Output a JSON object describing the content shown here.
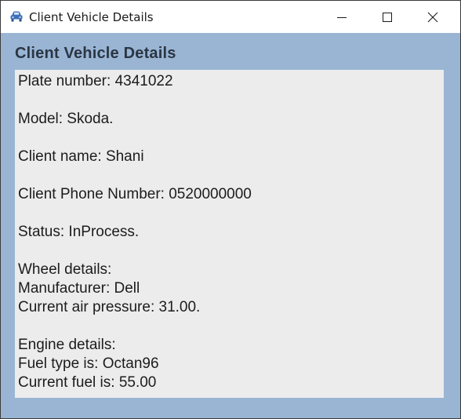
{
  "window": {
    "title": "Client Vehicle Details",
    "icon": "car-icon"
  },
  "controls": {
    "minimize": "minimize-icon",
    "maximize": "maximize-icon",
    "close": "close-icon"
  },
  "form": {
    "heading": "Client Vehicle Details"
  },
  "details": {
    "plate": "Plate number: 4341022",
    "model": "Model: Skoda.",
    "client_name": "Client name: Shani",
    "client_phone": "Client Phone Number: 0520000000",
    "status": "Status: InProcess.",
    "wheel_header": "Wheel details:",
    "wheel_manufacturer": "Manufacturer: Dell",
    "wheel_pressure": "Current air pressure: 31.00.",
    "engine_header": "Engine details:",
    "fuel_type": "Fuel type is: Octan96",
    "fuel_current": "Current fuel is: 55.00"
  },
  "colors": {
    "form_background": "#9ab5d4",
    "details_background": "#ececec",
    "heading": "#2b3644"
  }
}
